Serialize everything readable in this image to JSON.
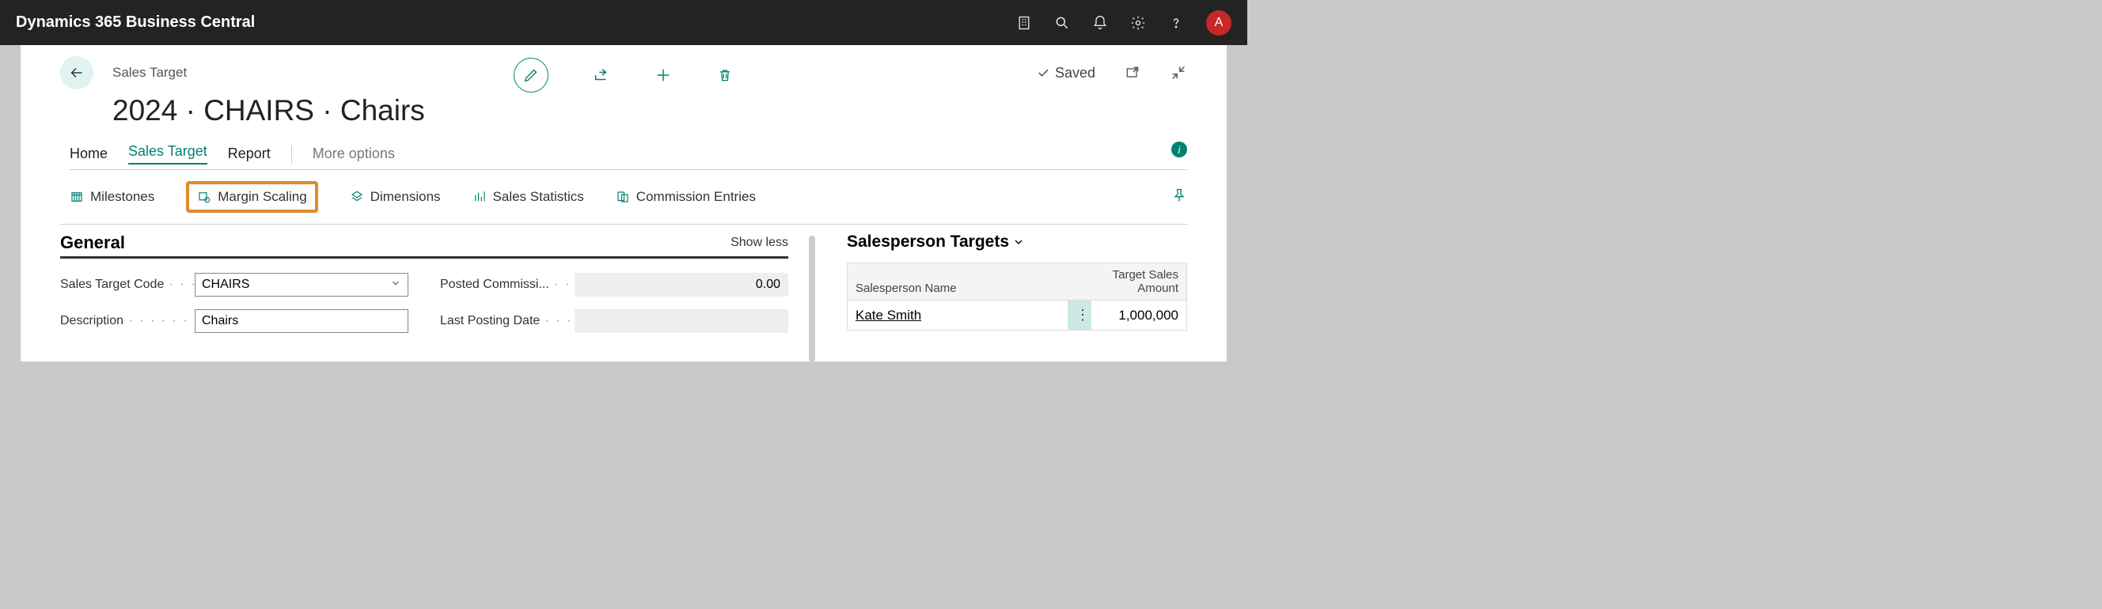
{
  "titlebar": {
    "app_name": "Dynamics 365 Business Central",
    "avatar_initial": "A"
  },
  "header": {
    "breadcrumb": "Sales Target",
    "record_title": "2024 · CHAIRS · Chairs",
    "saved_label": "Saved"
  },
  "tabs": {
    "home": "Home",
    "sales_target": "Sales Target",
    "report": "Report",
    "more": "More options"
  },
  "subactions": {
    "milestones": "Milestones",
    "margin_scaling": "Margin Scaling",
    "dimensions": "Dimensions",
    "sales_statistics": "Sales Statistics",
    "commission_entries": "Commission Entries"
  },
  "general": {
    "heading": "General",
    "show_less": "Show less",
    "fields": {
      "sales_target_code_label": "Sales Target Code",
      "sales_target_code_value": "CHAIRS",
      "description_label": "Description",
      "description_value": "Chairs",
      "posted_commission_label": "Posted Commissi...",
      "posted_commission_value": "0.00",
      "last_posting_date_label": "Last Posting Date",
      "last_posting_date_value": ""
    }
  },
  "salesperson": {
    "heading": "Salesperson Targets",
    "col_name": "Salesperson Name",
    "col_amount_l1": "Target Sales",
    "col_amount_l2": "Amount",
    "rows": [
      {
        "name": "Kate Smith",
        "amount": "1,000,000"
      }
    ]
  }
}
